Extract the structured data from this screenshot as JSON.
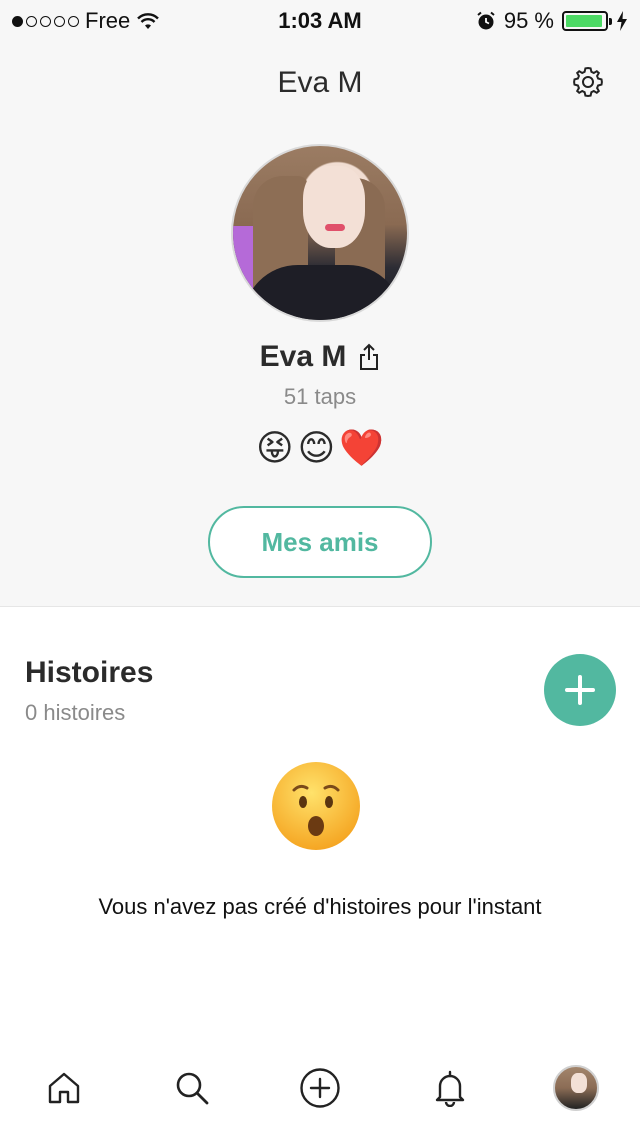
{
  "status_bar": {
    "carrier": "Free",
    "time": "1:03 AM",
    "battery_percent": "95 %",
    "battery_level": 0.95,
    "signal_dots_filled": 1,
    "signal_dots_total": 5
  },
  "header": {
    "title": "Eva M"
  },
  "profile": {
    "name": "Eva M",
    "taps": "51 taps",
    "emojis": [
      "😝",
      "😊",
      "❤️"
    ]
  },
  "friends_button": {
    "label": "Mes amis"
  },
  "stories": {
    "title": "Histoires",
    "count": "0 histoires",
    "empty_message": "Vous n'avez pas créé d'histoires pour l'instant"
  },
  "tabbar": {
    "items": [
      "home-icon",
      "search-icon",
      "add-circle-icon",
      "bell-icon",
      "profile-avatar"
    ]
  },
  "colors": {
    "accent": "#52b8a0",
    "header_bg": "#f7f7f7",
    "battery": "#4cd964"
  }
}
